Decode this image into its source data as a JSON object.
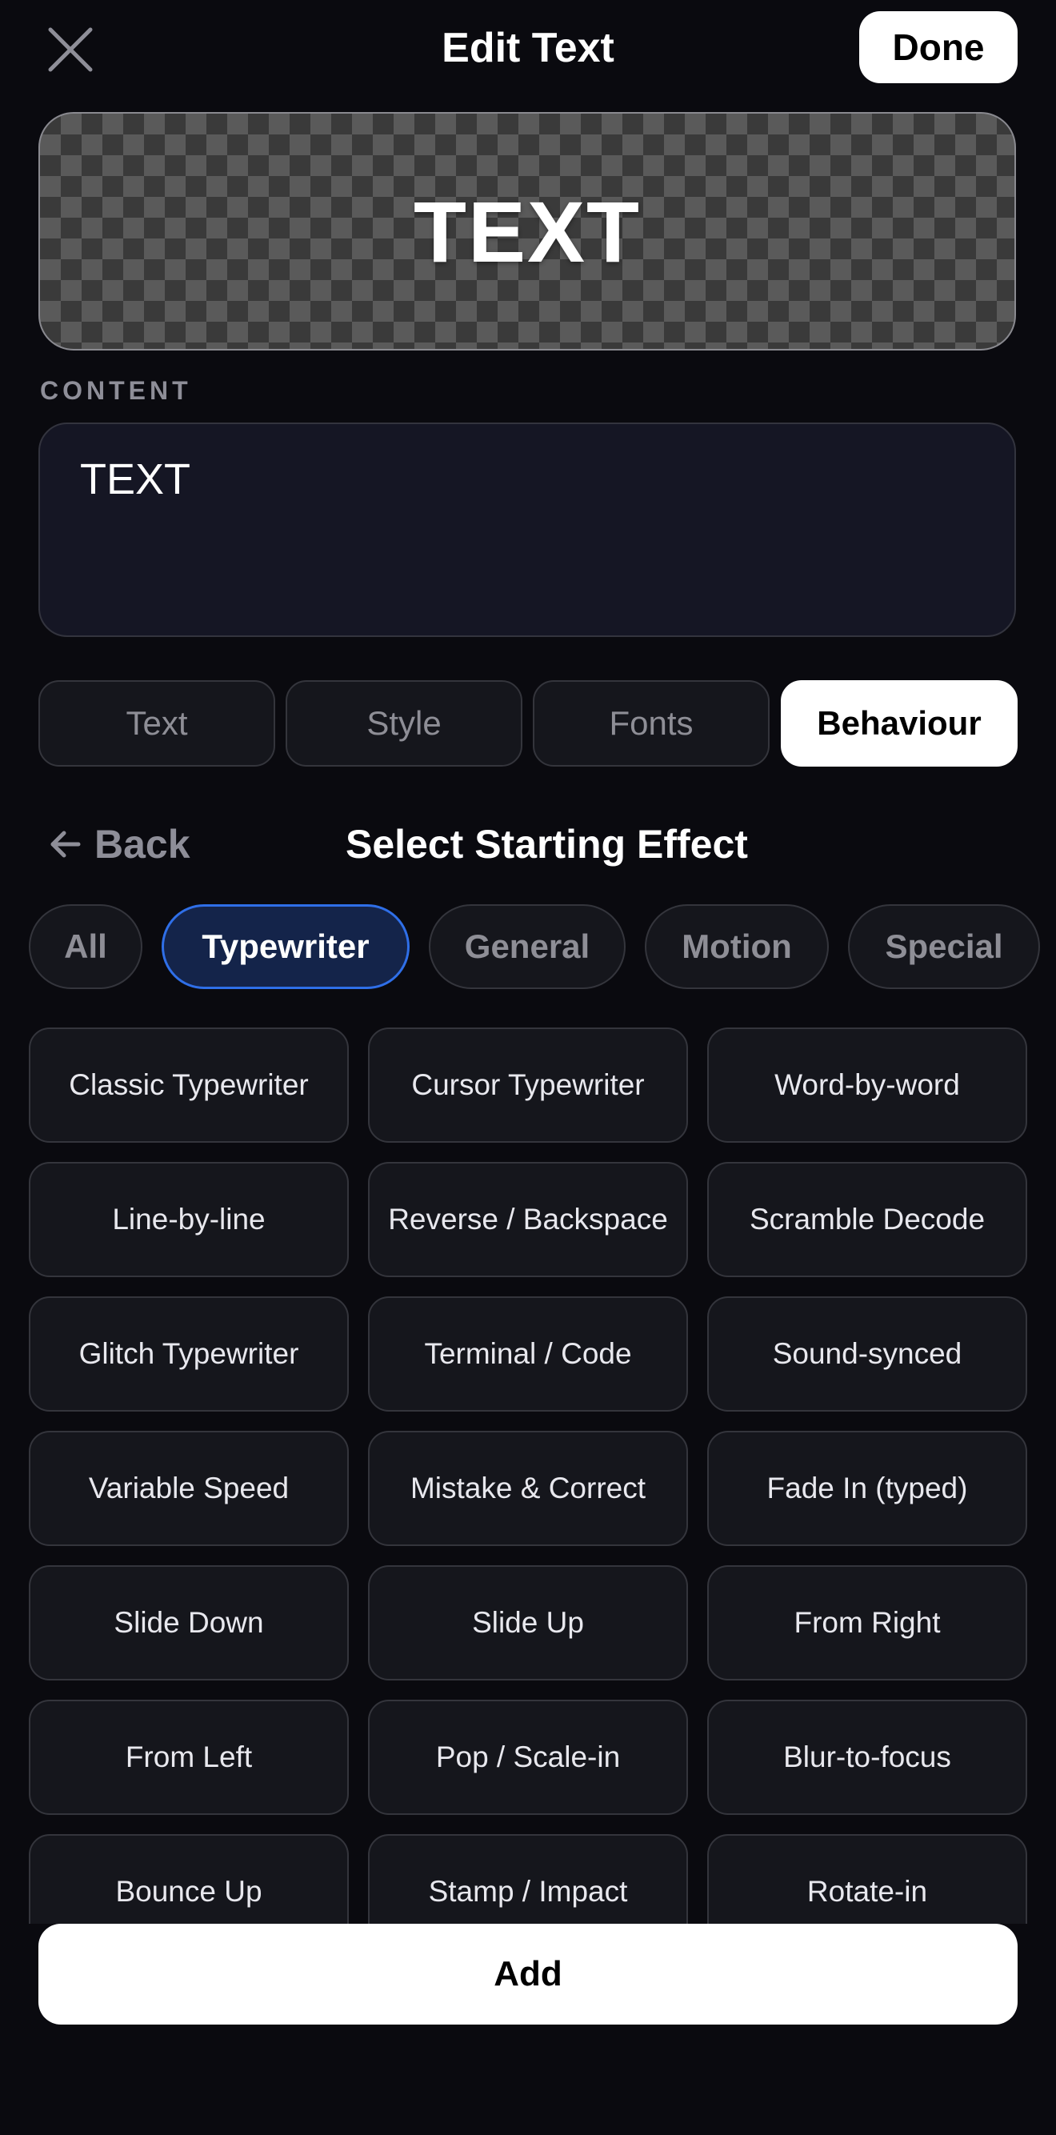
{
  "header": {
    "title": "Edit Text",
    "done_label": "Done",
    "close_icon": "close-icon"
  },
  "preview": {
    "text": "TEXT"
  },
  "content": {
    "label": "CONTENT",
    "value": "TEXT"
  },
  "tabs": [
    {
      "label": "Text",
      "active": false
    },
    {
      "label": "Style",
      "active": false
    },
    {
      "label": "Fonts",
      "active": false
    },
    {
      "label": "Behaviour",
      "active": true
    }
  ],
  "subheader": {
    "back_label": "Back",
    "back_icon": "arrow-left-icon",
    "title": "Select Starting Effect"
  },
  "categories": [
    {
      "label": "All",
      "active": false
    },
    {
      "label": "Typewriter",
      "active": true
    },
    {
      "label": "General",
      "active": false
    },
    {
      "label": "Motion",
      "active": false
    },
    {
      "label": "Special",
      "active": false
    }
  ],
  "effects": [
    "Classic Typewriter",
    "Cursor Typewriter",
    "Word-by-word",
    "Line-by-line",
    "Reverse / Backspace",
    "Scramble Decode",
    "Glitch Typewriter",
    "Terminal / Code",
    "Sound-synced",
    "Variable Speed",
    "Mistake & Correct",
    "Fade In (typed)",
    "Slide Down",
    "Slide Up",
    "From Right",
    "From Left",
    "Pop / Scale-in",
    "Blur-to-focus",
    "Bounce Up",
    "Stamp / Impact",
    "Rotate-in"
  ],
  "footer": {
    "add_label": "Add"
  },
  "colors": {
    "background": "#0a0a0f",
    "accent_blue": "#2f6fe8",
    "surface": "#15161c"
  }
}
